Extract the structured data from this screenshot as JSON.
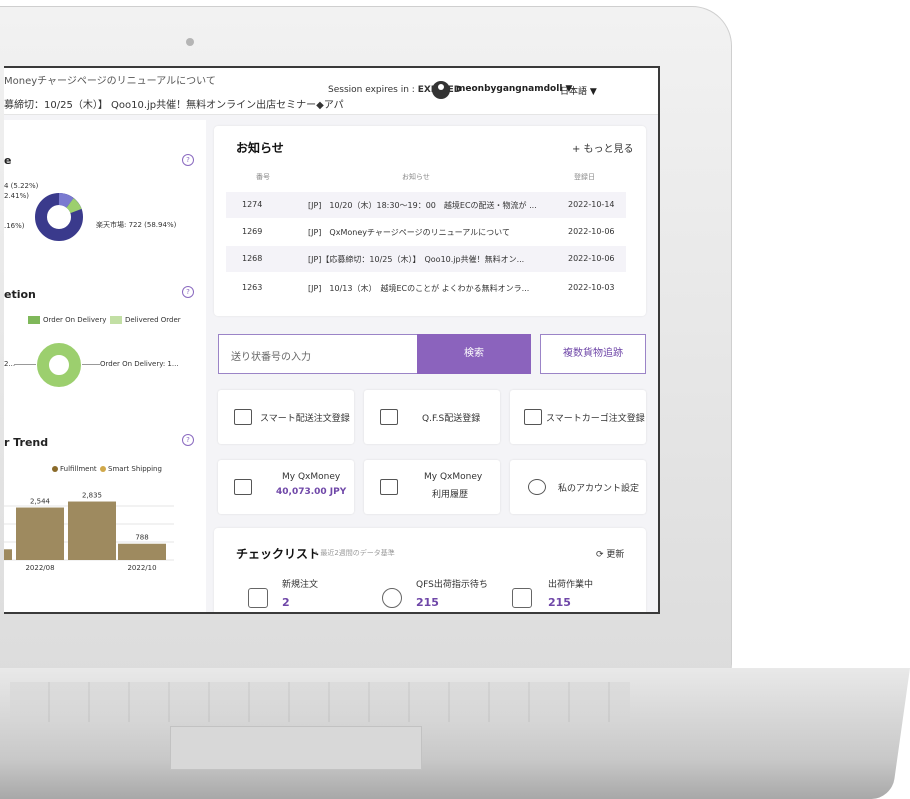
{
  "header": {
    "ticker_line1": "Moneyチャージページのリニューアルについて",
    "ticker_line2": "募締切：10/25（木）】 Qoo10.jp共催！無料オンライン出店セミナー◆アパ",
    "session_label": "Session expires in :",
    "session_status": "EXPIRED",
    "username": "meonbygangnamdoll ▼",
    "language": "日本語 ▼"
  },
  "left_widgets": {
    "widget1": {
      "title": "e",
      "legend_lines": [
        "4 (5.22%)",
        "2.41%)",
        ".16%)"
      ],
      "main_label": "楽天市場: 722 (58.94%)"
    },
    "widget2": {
      "title": "etion",
      "legend": [
        "Order On Delivery",
        "Delivered Order"
      ],
      "left_label": "2...",
      "right_label": "Order On Delivery: 1..."
    },
    "widget3": {
      "title": "r Trend",
      "legend": [
        "Fulfillment",
        "Smart Shipping"
      ],
      "x_labels": [
        "2022/08",
        "2022/10"
      ]
    }
  },
  "chart_data": {
    "type": "bar",
    "categories": [
      "",
      "2022/08",
      "",
      "2022/10"
    ],
    "values": [
      520,
      2544,
      2835,
      788
    ],
    "data_labels": [
      "",
      "2,544",
      "2,835",
      "788"
    ],
    "legend": [
      "Fulfillment",
      "Smart Shipping"
    ],
    "ylim": [
      0,
      3200
    ]
  },
  "notices": {
    "title": "お知らせ",
    "more": "+ もっと見る",
    "col_no": "番号",
    "col_notice": "お知らせ",
    "col_date": "登録日",
    "rows": [
      {
        "no": "1274",
        "text": "[JP]　10/20（木）18:30～19：00　越境ECの配送・物流が ...",
        "date": "2022-10-14"
      },
      {
        "no": "1269",
        "text": "[JP]　QxMoneyチャージページのリニューアルについて",
        "date": "2022-10-06"
      },
      {
        "no": "1268",
        "text": "[JP]【応募締切：10/25（木）】　Qoo10.jp共催！無料オン...",
        "date": "2022-10-06"
      },
      {
        "no": "1263",
        "text": "[JP]　10/13（木）　越境ECのことが よくわかる無料オンラ...",
        "date": "2022-10-03"
      }
    ]
  },
  "search": {
    "placeholder": "送り状番号の入力",
    "button": "検索",
    "multi": "複数貨物追跡"
  },
  "tiles": {
    "smart_order": "スマート配送注文登録",
    "qfs_order": "Q.F.S配送登録",
    "cargo_order": "スマートカーゴ注文登録",
    "qxmoney_label": "My QxMoney",
    "qxmoney_value": "40,073.00 JPY",
    "qxmoney_hist_1": "My QxMoney",
    "qxmoney_hist_2": "利用履歴",
    "account": "私のアカウント設定"
  },
  "checklist": {
    "title": "チェックリスト",
    "subtitle": "• 最近2週間のデータ基準",
    "refresh": "更新",
    "items": [
      {
        "label": "新規注文",
        "value": "2"
      },
      {
        "label": "QFS出荷指示待ち",
        "value": "215"
      },
      {
        "label": "出荷作業中",
        "value": "215"
      }
    ]
  },
  "colors": {
    "accent": "#8b63bd",
    "bar": "#9e8a5f",
    "donut_main": "#3a3a8c",
    "donut_green": "#9ccf6e"
  }
}
